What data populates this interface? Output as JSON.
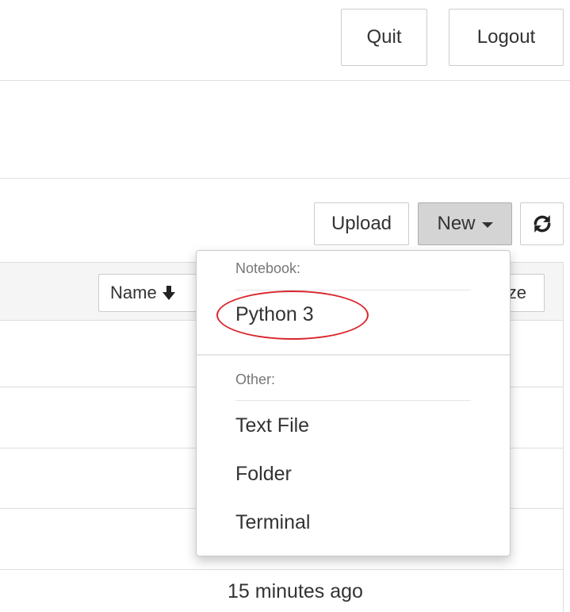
{
  "header": {
    "quit_label": "Quit",
    "logout_label": "Logout"
  },
  "toolbar": {
    "upload_label": "Upload",
    "new_label": "New",
    "refresh_icon": "refresh-icon"
  },
  "file_list": {
    "sort_label": "Name",
    "sort_icon": "arrow-down-icon",
    "size_label_partial": "ze",
    "last_modified_visible": "15 minutes ago"
  },
  "new_menu": {
    "notebook_header": "Notebook:",
    "kernels": [
      "Python 3"
    ],
    "other_header": "Other:",
    "other_items": [
      "Text File",
      "Folder",
      "Terminal"
    ]
  },
  "colors": {
    "highlight_ring": "#d9262c",
    "active_button_bg": "#d4d4d4"
  }
}
